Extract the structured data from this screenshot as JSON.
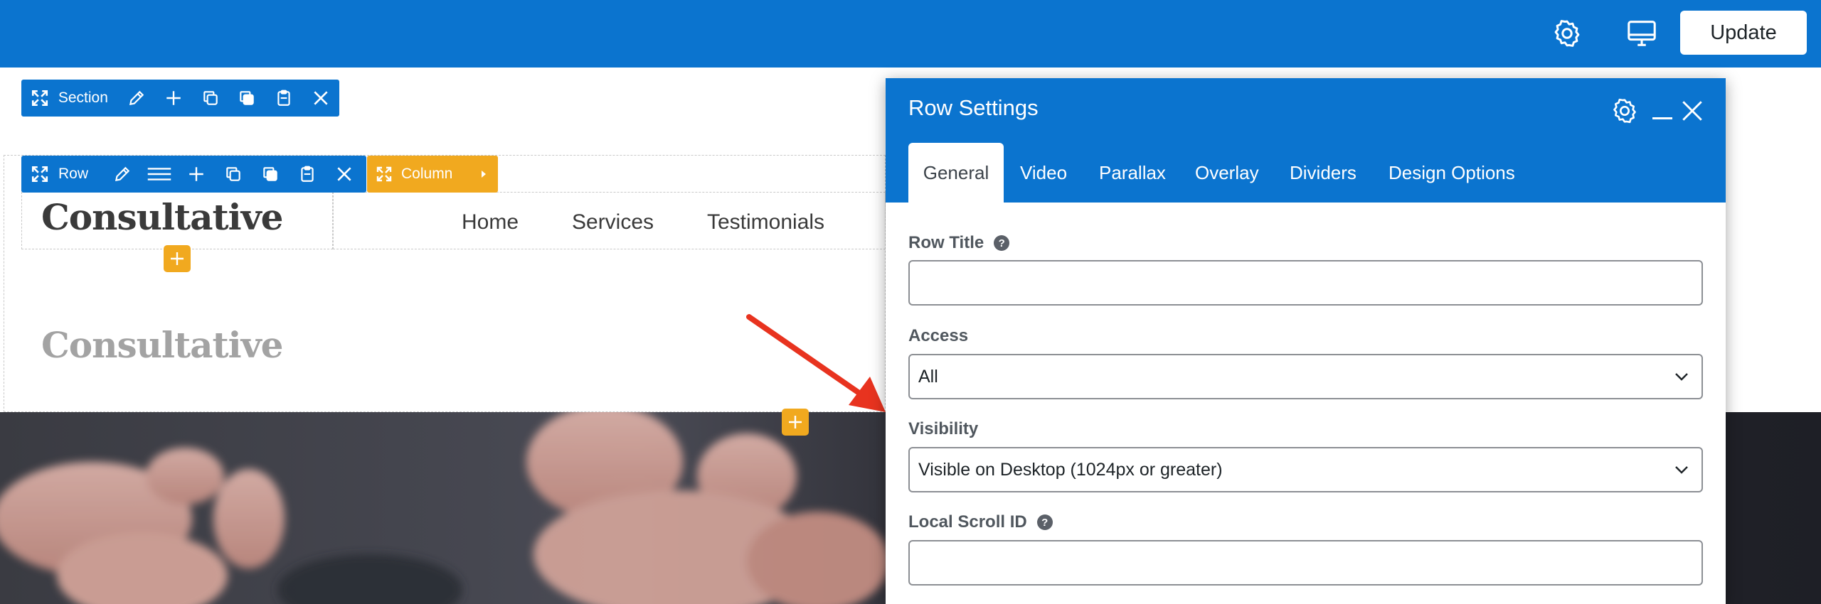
{
  "topbar": {
    "icons": [
      "gear-icon",
      "desktop-icon"
    ],
    "update_label": "Update"
  },
  "builder": {
    "section_label": "Section",
    "row_label": "Row",
    "column_label": "Column"
  },
  "site": {
    "brand": "Consultative",
    "brand_faded": "Consultative",
    "nav": [
      "Home",
      "Services",
      "Testimonials"
    ]
  },
  "panel": {
    "title": "Row Settings",
    "tabs": [
      {
        "label": "General",
        "active": true
      },
      {
        "label": "Video",
        "active": false
      },
      {
        "label": "Parallax",
        "active": false
      },
      {
        "label": "Overlay",
        "active": false
      },
      {
        "label": "Dividers",
        "active": false
      },
      {
        "label": "Design Options",
        "active": false
      }
    ],
    "fields": {
      "row_title_label": "Row Title",
      "row_title_value": "",
      "access_label": "Access",
      "access_value": "All",
      "visibility_label": "Visibility",
      "visibility_value": "Visible on Desktop (1024px or greater)",
      "scroll_id_label": "Local Scroll ID",
      "scroll_id_value": ""
    }
  },
  "colors": {
    "accent_blue": "#0b74cf",
    "builder_orange": "#f1a91f",
    "arrow_red": "#e8331f"
  }
}
